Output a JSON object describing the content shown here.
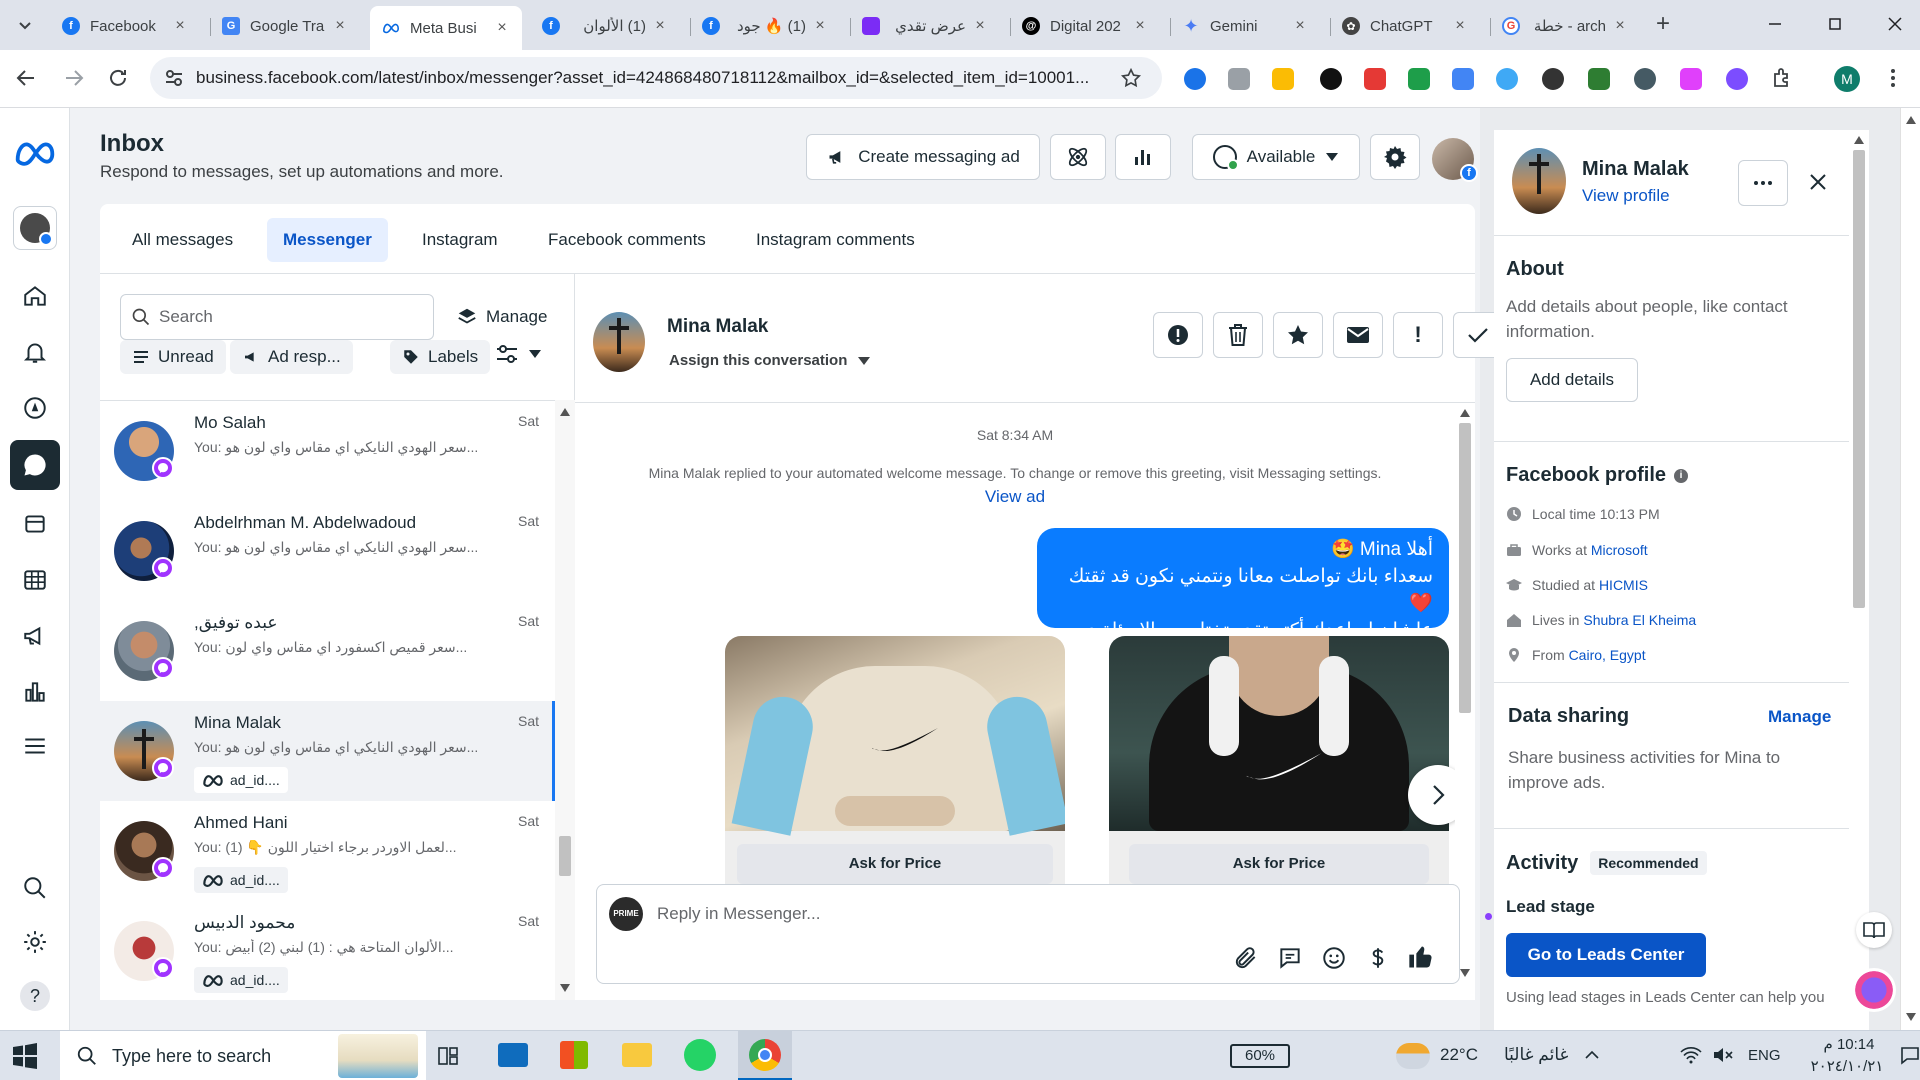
{
  "browser": {
    "tabs": [
      {
        "title": "Facebook",
        "icon": "facebook-icon",
        "color": "#1877f2"
      },
      {
        "title": "Google Tra",
        "icon": "google-translate-icon",
        "color": "#4285f4"
      },
      {
        "title": "Meta Busi",
        "icon": "meta-icon",
        "color": "#0668e1",
        "active": true
      },
      {
        "title": "(1) الألوان",
        "icon": "facebook-icon",
        "color": "#1877f2"
      },
      {
        "title": "(1) 🔥 جود",
        "icon": "facebook-icon",
        "color": "#1877f2"
      },
      {
        "title": "عرض تقدي",
        "icon": "app-icon",
        "color": "#7b2cf5"
      },
      {
        "title": "Digital 202",
        "icon": "threads-icon",
        "color": "#000000"
      },
      {
        "title": "Gemini",
        "icon": "gemini-icon",
        "color": "#4b7cf3"
      },
      {
        "title": "ChatGPT",
        "icon": "chatgpt-icon",
        "color": "#444444"
      },
      {
        "title": "arch - خطة",
        "icon": "google-icon",
        "color": "#ea4335"
      }
    ],
    "url": "business.facebook.com/latest/inbox/messenger?asset_id=424868480718112&mailbox_id=&selected_item_id=10001...",
    "profile_initial": "M"
  },
  "header": {
    "title": "Inbox",
    "subtitle": "Respond to messages, set up automations and more.",
    "create_ad_label": "Create messaging ad",
    "available_label": "Available"
  },
  "tabs": [
    "All messages",
    "Messenger",
    "Instagram",
    "Facebook comments",
    "Instagram comments"
  ],
  "list": {
    "search_placeholder": "Search",
    "manage_label": "Manage",
    "filters": [
      "Unread",
      "Ad resp...",
      "Labels"
    ],
    "conversations": [
      {
        "name": "Mo Salah",
        "preview": "You: سعر الهودي النايكي اي مقاس واي لون هو...",
        "date": "Sat",
        "tag": ""
      },
      {
        "name": "Abdelrhman M. Abdelwadoud",
        "preview": "You: سعر الهودي النايكي اي مقاس واي لون هو...",
        "date": "Sat",
        "tag": ""
      },
      {
        "name": "عبده توفيق,",
        "preview": "You: سعر قميص اكسفورد اي مقاس واي لون...",
        "date": "Sat",
        "tag": ""
      },
      {
        "name": "Mina Malak",
        "preview": "You: سعر الهودي النايكي اي مقاس واي لون هو...",
        "date": "Sat",
        "tag": "ad_id...."
      },
      {
        "name": "Ahmed Hani",
        "preview": "You: (1) 👇 لعمل الاوردر برجاء اختيار اللون...",
        "date": "Sat",
        "tag": "ad_id...."
      },
      {
        "name": "محمود الدبيس",
        "preview": "You: الألوان المتاحة هي : (1) لبني (2) أبيض...",
        "date": "Sat",
        "tag": "ad_id...."
      }
    ]
  },
  "conversation": {
    "name": "Mina Malak",
    "assign_label": "Assign this conversation",
    "timestamp": "Sat 8:34 AM",
    "system_note": "Mina Malak replied to your automated welcome message. To change or remove this greeting, visit Messaging settings.",
    "view_ad": "View ad",
    "message_lines": [
      "أهلا Mina 🤩",
      "سعداء بانك تواصلت معانا ونتمني نكون قد ثقتك ❤️",
      "علشان اساعدك أكتر تقدر تختار من الاسئلة دي 👇"
    ],
    "product_button": "Ask for Price",
    "reply_placeholder": "Reply in Messenger..."
  },
  "profile": {
    "name": "Mina Malak",
    "view_profile": "View profile",
    "about_title": "About",
    "about_text": "Add details about people, like contact information.",
    "add_details": "Add details",
    "fb_title": "Facebook profile",
    "local_time": "Local time 10:13 PM",
    "works_prefix": "Works at ",
    "works": "Microsoft",
    "studied_prefix": "Studied at ",
    "studied": "HICMIS",
    "lives_prefix": "Lives in ",
    "lives": "Shubra El Kheima",
    "from_prefix": "From ",
    "from": "Cairo, Egypt",
    "sharing_title": "Data sharing",
    "sharing_manage": "Manage",
    "sharing_text": "Share business activities for Mina to improve ads.",
    "activity_title": "Activity",
    "recommended": "Recommended",
    "lead_stage": "Lead stage",
    "leads_button": "Go to Leads Center",
    "leads_text": "Using lead stages in Leads Center can help you"
  },
  "taskbar": {
    "search_placeholder": "Type here to search",
    "battery": "60%",
    "weather_temp": "22°C",
    "weather_text": "غائم غالبًا",
    "lang": "ENG",
    "time": "10:14 م",
    "date": "٢٠٢٤/١٠/٢١"
  },
  "colors": {
    "accent": "#1877f2",
    "bubble": "#0a7cff",
    "nav_active": "#1c2b33",
    "leads_btn": "#0a55c7"
  }
}
